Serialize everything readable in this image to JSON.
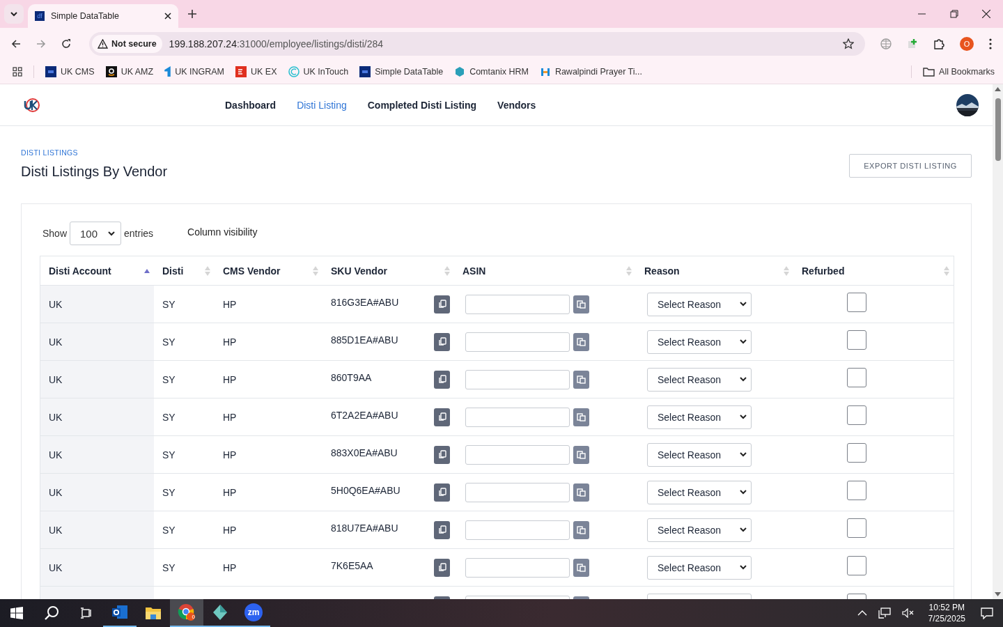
{
  "browser": {
    "tab": {
      "title": "Simple DataTable",
      "icon_text": "df"
    },
    "security": "Not secure",
    "url_host": "199.188.207.24",
    "url_rest": ":31000/employee/listings/disti/284",
    "profile": "O",
    "bookmarks": [
      {
        "label": "UK CMS",
        "kind": "df"
      },
      {
        "label": "UK AMZ",
        "kind": "amz"
      },
      {
        "label": "UK INGRAM",
        "kind": "ingram"
      },
      {
        "label": "UK EX",
        "kind": "ex"
      },
      {
        "label": "UK InTouch",
        "kind": "intouch"
      },
      {
        "label": "Simple DataTable",
        "kind": "df"
      },
      {
        "label": "Comtanix HRM",
        "kind": "hex"
      },
      {
        "label": "Rawalpindi Prayer Ti...",
        "kind": "prayer"
      }
    ],
    "all_bookmarks": "All Bookmarks"
  },
  "nav": [
    {
      "label": "Dashboard",
      "selected": false
    },
    {
      "label": "Disti Listing",
      "selected": true
    },
    {
      "label": "Completed Disti Listing",
      "selected": false
    },
    {
      "label": "Vendors",
      "selected": false
    }
  ],
  "breadcrumb": "DISTI LISTINGS",
  "title": "Disti Listings By Vendor",
  "export_button": "EXPORT DISTI LISTING",
  "length": {
    "before": "Show",
    "value": "100",
    "after": "entries"
  },
  "column_visibility": "Column visibility",
  "table": {
    "columns": [
      {
        "label": "Disti Account",
        "sorted": true
      },
      {
        "label": "Disti",
        "sorted": false
      },
      {
        "label": "CMS Vendor",
        "sorted": false
      },
      {
        "label": "SKU Vendor",
        "sorted": false
      },
      {
        "label": "ASIN",
        "sorted": false
      },
      {
        "label": "Reason",
        "sorted": false
      },
      {
        "label": "Refurbed",
        "sorted": false
      }
    ],
    "rows": [
      {
        "account": "UK",
        "disti": "SY",
        "cms_vendor": "HP",
        "sku_vendor": "816G3EA#ABU",
        "reason": "Select Reason",
        "refurbed": false
      },
      {
        "account": "UK",
        "disti": "SY",
        "cms_vendor": "HP",
        "sku_vendor": "885D1EA#ABU",
        "reason": "Select Reason",
        "refurbed": false
      },
      {
        "account": "UK",
        "disti": "SY",
        "cms_vendor": "HP",
        "sku_vendor": "860T9AA",
        "reason": "Select Reason",
        "refurbed": false
      },
      {
        "account": "UK",
        "disti": "SY",
        "cms_vendor": "HP",
        "sku_vendor": "6T2A2EA#ABU",
        "reason": "Select Reason",
        "refurbed": false
      },
      {
        "account": "UK",
        "disti": "SY",
        "cms_vendor": "HP",
        "sku_vendor": "883X0EA#ABU",
        "reason": "Select Reason",
        "refurbed": false
      },
      {
        "account": "UK",
        "disti": "SY",
        "cms_vendor": "HP",
        "sku_vendor": "5H0Q6EA#ABU",
        "reason": "Select Reason",
        "refurbed": false
      },
      {
        "account": "UK",
        "disti": "SY",
        "cms_vendor": "HP",
        "sku_vendor": "818U7EA#ABU",
        "reason": "Select Reason",
        "refurbed": false
      },
      {
        "account": "UK",
        "disti": "SY",
        "cms_vendor": "HP",
        "sku_vendor": "7K6E5AA",
        "reason": "Select Reason",
        "refurbed": false
      }
    ],
    "cut_off_row": {
      "refurbed": false
    }
  },
  "taskbar": {
    "time": "10:52 PM",
    "date": "7/25/2025",
    "chrome_badge": "0",
    "zoom_label": "zm"
  }
}
